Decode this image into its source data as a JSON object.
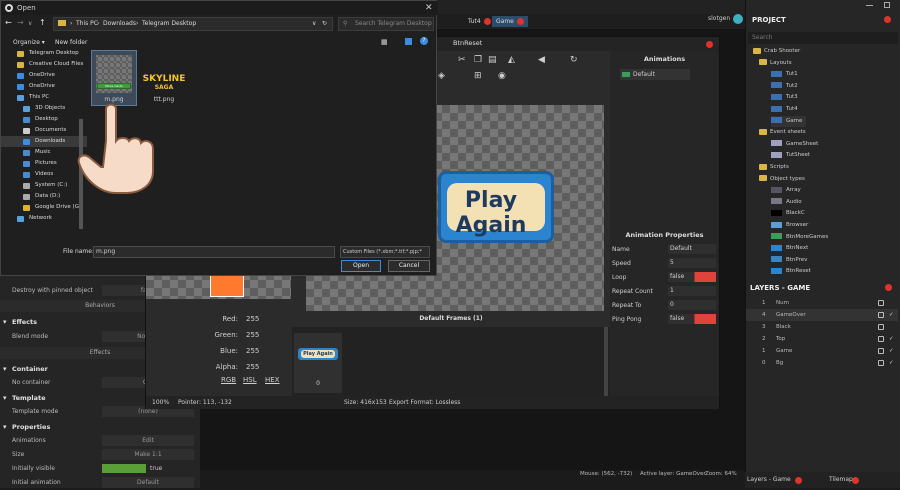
{
  "editor": {
    "tabs": [
      "Tut4",
      "Game"
    ],
    "user": "slotgen",
    "project_title": "PROJECT",
    "search_placeholder": "Search",
    "tree": {
      "root": "Crab Shooter",
      "layouts_folder": "Layouts",
      "layouts": [
        "Tut1",
        "Tut2",
        "Tut3",
        "Tut4",
        "Game"
      ],
      "event_sheets_folder": "Event sheets",
      "event_sheets": [
        "GameSheet",
        "TutSheet"
      ],
      "scripts_folder": "Scripts",
      "object_types_folder": "Object types",
      "object_types": [
        "Array",
        "Audio",
        "BlackC",
        "Browser",
        "BtnMoreGames",
        "BtnNext",
        "BtnPrev",
        "BtnReset"
      ]
    },
    "layers_title": "LAYERS - GAME",
    "layers": [
      {
        "n": "1",
        "name": "Num",
        "check": false
      },
      {
        "n": "4",
        "name": "GameOver",
        "check": true
      },
      {
        "n": "3",
        "name": "Black",
        "check": false
      },
      {
        "n": "2",
        "name": "Top",
        "check": true
      },
      {
        "n": "1",
        "name": "Game",
        "check": true
      },
      {
        "n": "0",
        "name": "Bg",
        "check": true
      }
    ],
    "bottom_tabs": [
      "Layers - Game",
      "Tilemap"
    ],
    "status_mouse": "Mouse: (562, -732)",
    "status_layer": "Active layer: GameOver",
    "status_zoom": "Zoom: 64%"
  },
  "left_panel": {
    "destroy_label": "Destroy with pinned object",
    "destroy_value": "false",
    "behaviors": "Behaviors",
    "effects_header": "Effects",
    "blend_label": "Blend mode",
    "blend_value": "Normal",
    "effects_sub": "Effects",
    "container_header": "Container",
    "no_container": "No container",
    "create": "Cre",
    "template_header": "Template",
    "template_mode": "Template mode",
    "template_value": "(none)",
    "properties_header": "Properties",
    "animations": "Animations",
    "edit": "Edit",
    "size": "Size",
    "make11": "Make 1:1",
    "initially_visible": "Initially visible",
    "iv_value": "true",
    "initial_animation": "Initial animation",
    "ia_value": "Default"
  },
  "image_editor": {
    "title": "BtnReset",
    "button_text": "Play Again",
    "frames_title": "Default Frames (1)",
    "frame_index": "0",
    "red_label": "Red:",
    "red": "255",
    "green_label": "Green:",
    "green": "255",
    "blue_label": "Blue:",
    "blue": "255",
    "alpha_label": "Alpha:",
    "alpha": "255",
    "modes": [
      "RGB",
      "HSL",
      "HEX"
    ],
    "zoom": "100%",
    "pointer": "Pointer: 113, -132",
    "size": "Size: 416x153",
    "export": "Export Format: Lossless",
    "animations_title": "Animations",
    "animation_default": "Default",
    "anim_props_title": "Animation Properties",
    "props": [
      {
        "k": "Name",
        "v": "Default"
      },
      {
        "k": "Speed",
        "v": "5"
      },
      {
        "k": "Loop",
        "v": "false"
      },
      {
        "k": "Repeat Count",
        "v": "1"
      },
      {
        "k": "Repeat To",
        "v": "0"
      },
      {
        "k": "Ping Pong",
        "v": "false"
      }
    ]
  },
  "dialog": {
    "title": "Open",
    "path": [
      "This PC",
      "Downloads",
      "Telegram Desktop"
    ],
    "search_placeholder": "Search Telegram Desktop",
    "organize": "Organize ▾",
    "new_folder": "New folder",
    "nav": [
      {
        "label": "Telegram Desktop",
        "color": "#d9b545"
      },
      {
        "label": "Creative Cloud Files",
        "color": "#d9b545"
      },
      {
        "label": "OneDrive",
        "color": "#3b8de0"
      },
      {
        "label": "OneDrive",
        "color": "#3b8de0"
      },
      {
        "label": "This PC",
        "color": "#5aa0e0"
      },
      {
        "label": "3D Objects",
        "color": "#5aa0e0"
      },
      {
        "label": "Desktop",
        "color": "#4a8ad0"
      },
      {
        "label": "Documents",
        "color": "#cccccc"
      },
      {
        "label": "Downloads",
        "color": "#3b8de0"
      },
      {
        "label": "Music",
        "color": "#4a8ad0"
      },
      {
        "label": "Pictures",
        "color": "#4a8ad0"
      },
      {
        "label": "Videos",
        "color": "#4a8ad0"
      },
      {
        "label": "System (C:)",
        "color": "#aaaaaa"
      },
      {
        "label": "Data (D:)",
        "color": "#aaaaaa"
      },
      {
        "label": "Google Drive (G:)",
        "color": "#e0b030"
      },
      {
        "label": "Network",
        "color": "#5aa0e0"
      }
    ],
    "files": [
      {
        "name": "m.png",
        "inner": "Move Cards"
      },
      {
        "name": "ttt.png",
        "logo1": "SKYLINE",
        "logo2": "SAGA"
      }
    ],
    "filename_label": "File name:",
    "filename": "m.png",
    "filter": "Custom Files (*.xbm;*.tif;*.pjp;*",
    "open": "Open",
    "cancel": "Cancel"
  }
}
